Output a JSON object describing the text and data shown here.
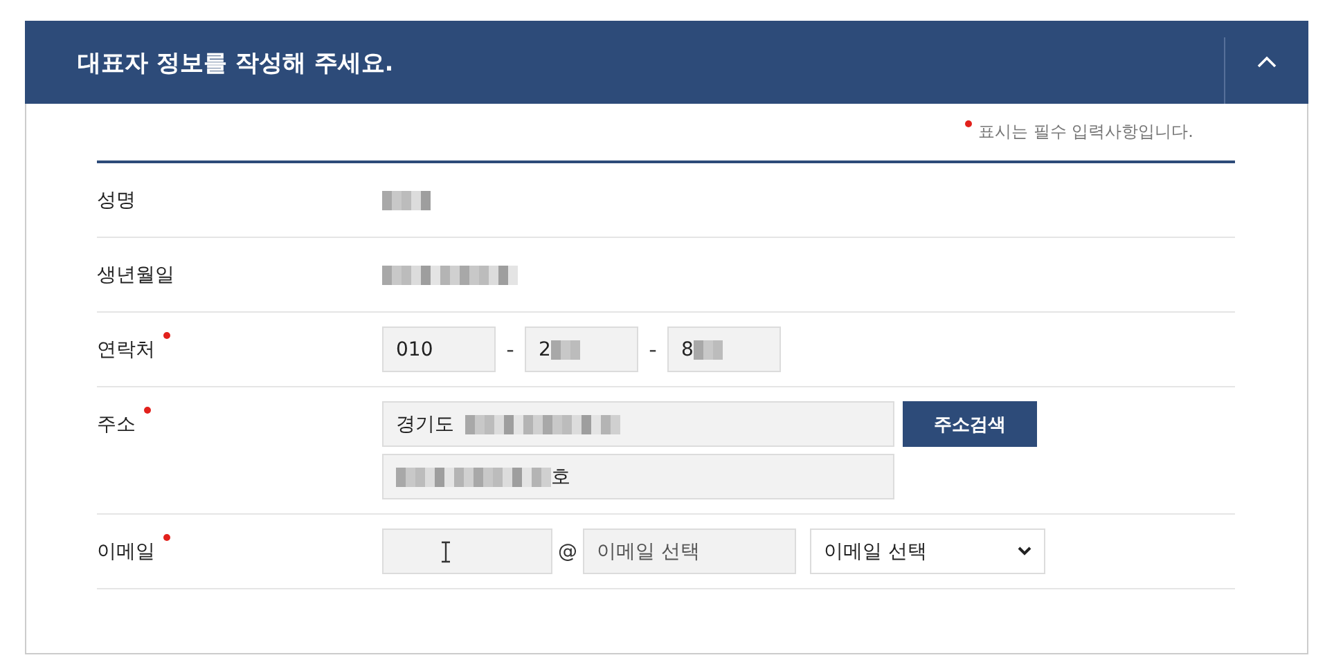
{
  "header": {
    "title": "대표자 정보를 작성해 주세요.",
    "expanded": true
  },
  "required_note": "표시는 필수 입력사항입니다.",
  "rows": [
    {
      "label": "성명",
      "required": false,
      "kind": "text",
      "blurred": true
    },
    {
      "label": "생년월일",
      "required": false,
      "kind": "text",
      "blurred": true
    },
    {
      "label": "연락처",
      "required": true,
      "kind": "phone",
      "fields": [
        {
          "value": "010",
          "blurred_before": false,
          "blurred_after": false
        },
        {
          "value": "2",
          "blurred_before": false,
          "blurred_after": true
        },
        {
          "value": "8",
          "blurred_before": false,
          "blurred_after": true
        }
      ],
      "separators": [
        "-",
        "-"
      ]
    },
    {
      "label": "주소",
      "required": true,
      "kind": "address",
      "fields": [
        {
          "value": "경기도",
          "blurred_before": false,
          "blurred_after": true
        },
        {
          "value": "호",
          "blurred_before": true,
          "blurred_after": false
        }
      ],
      "button": "주소검색"
    },
    {
      "label": "이메일",
      "required": true,
      "kind": "email",
      "at": "@",
      "domain_placeholder": "이메일 선택",
      "select_value": "이메일 선택"
    }
  ]
}
